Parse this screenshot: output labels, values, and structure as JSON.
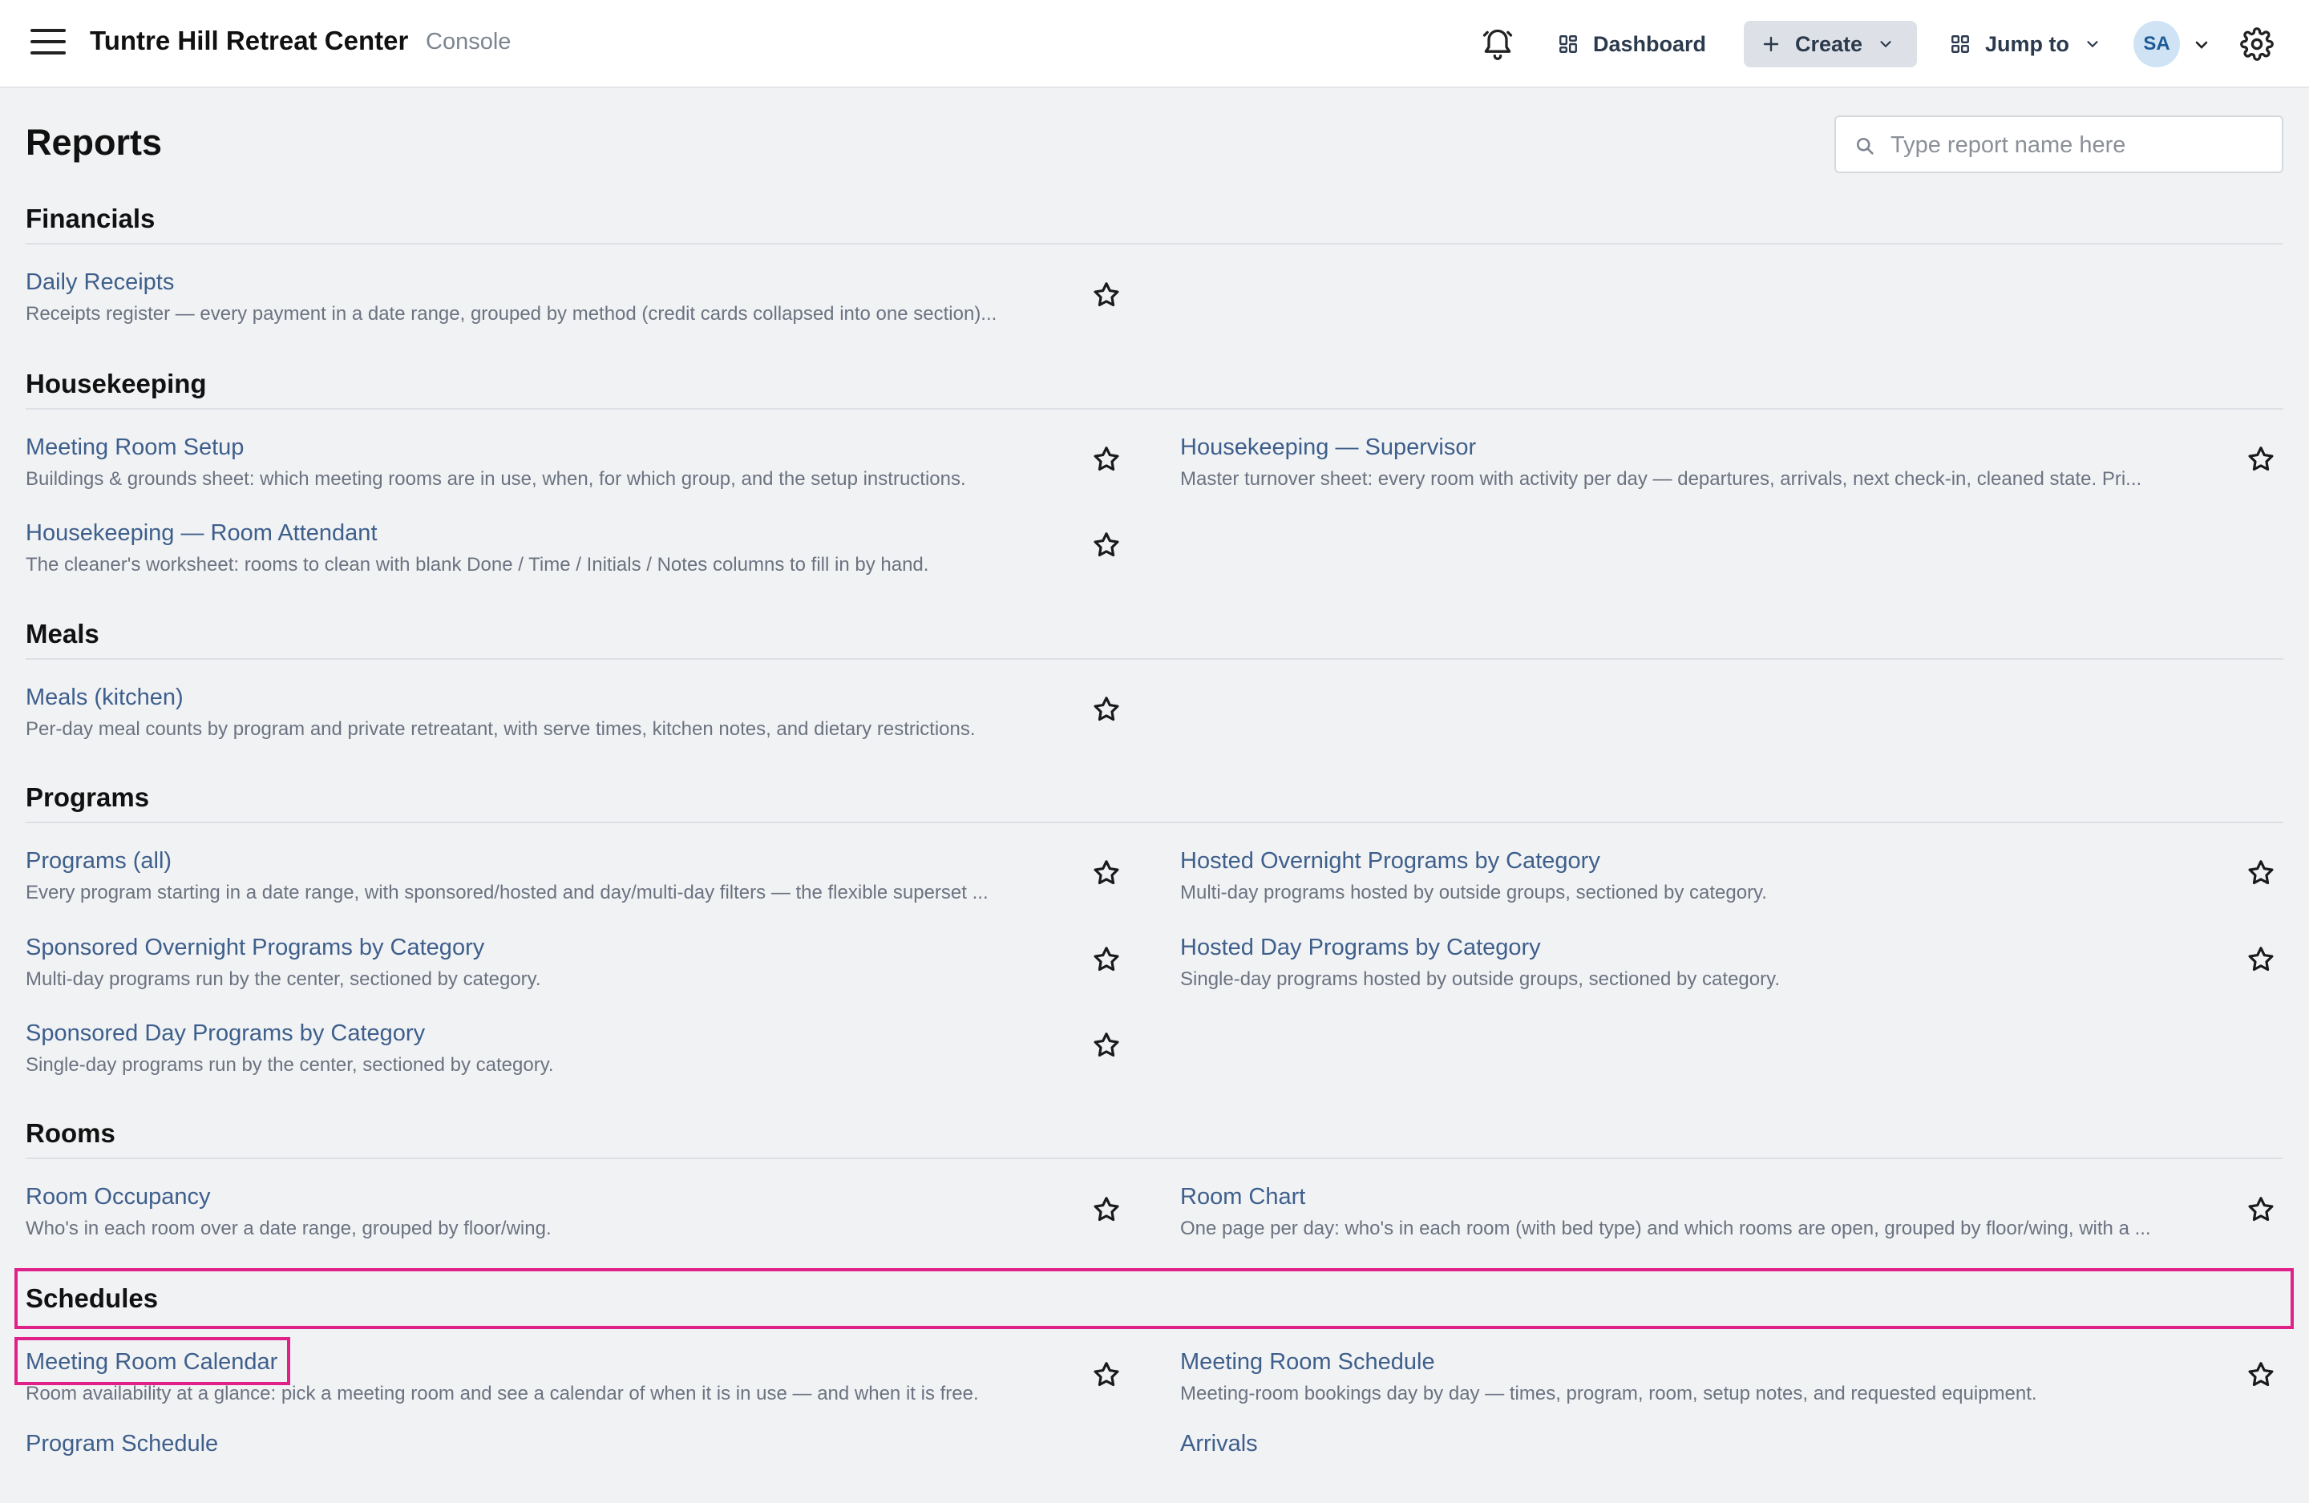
{
  "app": {
    "title": "Tuntre Hill Retreat Center",
    "subtitle": "Console"
  },
  "topnav": {
    "dashboard_label": "Dashboard",
    "create_label": "Create",
    "jump_label": "Jump to",
    "avatar_initials": "SA"
  },
  "page": {
    "title": "Reports"
  },
  "search": {
    "placeholder": "Type report name here"
  },
  "sections": {
    "financials": {
      "title": "Financials",
      "reports": [
        {
          "title": "Daily Receipts",
          "desc": "Receipts register — every payment in a date range, grouped by method (credit cards collapsed into one section)..."
        }
      ]
    },
    "housekeeping": {
      "title": "Housekeeping",
      "reports": [
        {
          "title": "Meeting Room Setup",
          "desc": "Buildings & grounds sheet: which meeting rooms are in use, when, for which group, and the setup instructions."
        },
        {
          "title": "Housekeeping — Supervisor",
          "desc": "Master turnover sheet: every room with activity per day — departures, arrivals, next check-in, cleaned state. Pri..."
        },
        {
          "title": "Housekeeping — Room Attendant",
          "desc": "The cleaner's worksheet: rooms to clean with blank Done / Time / Initials / Notes columns to fill in by hand."
        }
      ]
    },
    "meals": {
      "title": "Meals",
      "reports": [
        {
          "title": "Meals (kitchen)",
          "desc": "Per-day meal counts by program and private retreatant, with serve times, kitchen notes, and dietary restrictions."
        }
      ]
    },
    "programs": {
      "title": "Programs",
      "reports": [
        {
          "title": "Programs (all)",
          "desc": "Every program starting in a date range, with sponsored/hosted and day/multi-day filters — the flexible superset ..."
        },
        {
          "title": "Hosted Overnight Programs by Category",
          "desc": "Multi-day programs hosted by outside groups, sectioned by category."
        },
        {
          "title": "Sponsored Overnight Programs by Category",
          "desc": "Multi-day programs run by the center, sectioned by category."
        },
        {
          "title": "Hosted Day Programs by Category",
          "desc": "Single-day programs hosted by outside groups, sectioned by category."
        },
        {
          "title": "Sponsored Day Programs by Category",
          "desc": "Single-day programs run by the center, sectioned by category."
        }
      ]
    },
    "rooms": {
      "title": "Rooms",
      "reports": [
        {
          "title": "Room Occupancy",
          "desc": "Who's in each room over a date range, grouped by floor/wing."
        },
        {
          "title": "Room Chart",
          "desc": "One page per day: who's in each room (with bed type) and which rooms are open, grouped by floor/wing, with a ..."
        }
      ]
    },
    "schedules": {
      "title": "Schedules",
      "reports": [
        {
          "title": "Meeting Room Calendar",
          "desc": "Room availability at a glance: pick a meeting room and see a calendar of when it is in use — and when it is free."
        },
        {
          "title": "Meeting Room Schedule",
          "desc": "Meeting-room bookings day by day — times, program, room, setup notes, and requested equipment."
        },
        {
          "title": "Program Schedule",
          "desc": ""
        },
        {
          "title": "Arrivals",
          "desc": ""
        }
      ]
    }
  },
  "colors": {
    "link": "#3e5f8c",
    "highlight": "#e0218a",
    "accent_bg": "#dde1e7"
  }
}
